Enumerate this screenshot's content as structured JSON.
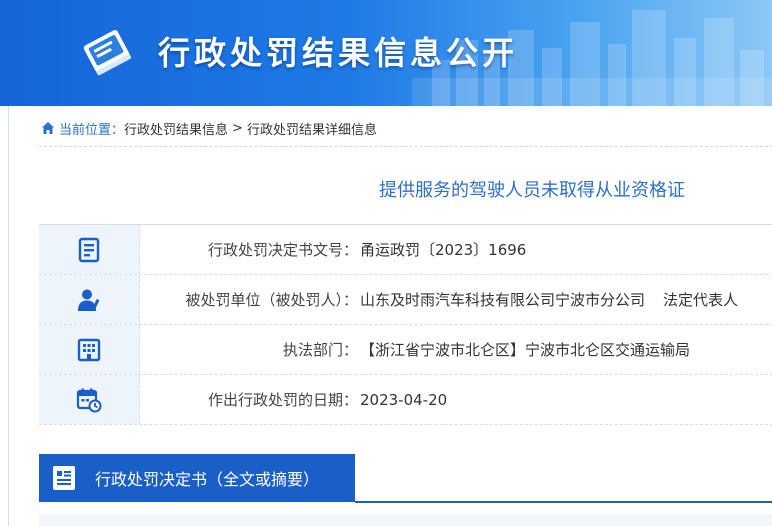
{
  "header": {
    "title": "行政处罚结果信息公开",
    "icon": "book-icon"
  },
  "breadcrumb": {
    "icon": "home-icon",
    "prefix": "当前位置：",
    "items": [
      "行政处罚结果信息",
      "行政处罚结果详细信息"
    ],
    "separator": ">"
  },
  "case": {
    "title": "提供服务的驾驶人员未取得从业资格证",
    "rows": [
      {
        "icon": "document-list-icon",
        "label": "行政处罚决定书文号：",
        "value": "甬运政罚〔2023〕1696"
      },
      {
        "icon": "person-icon",
        "label": "被处罚单位（被处罚人）：",
        "value": "山东及时雨汽车科技有限公司宁波市分公司",
        "extra": "法定代表人"
      },
      {
        "icon": "building-icon",
        "label": "执法部门：",
        "value": "【浙江省宁波市北仑区】宁波市北仑区交通运输局"
      },
      {
        "icon": "calendar-icon",
        "label": "作出行政处罚的日期：",
        "value": "2023-04-20"
      }
    ]
  },
  "section": {
    "title": "行政处罚决定书（全文或摘要）",
    "icon": "document-icon"
  },
  "colors": {
    "banner": "#1e7ae6",
    "accent": "#1a5ec8",
    "title_text": "#2e6fc9",
    "row_icon_bg": "#eef4fb"
  }
}
